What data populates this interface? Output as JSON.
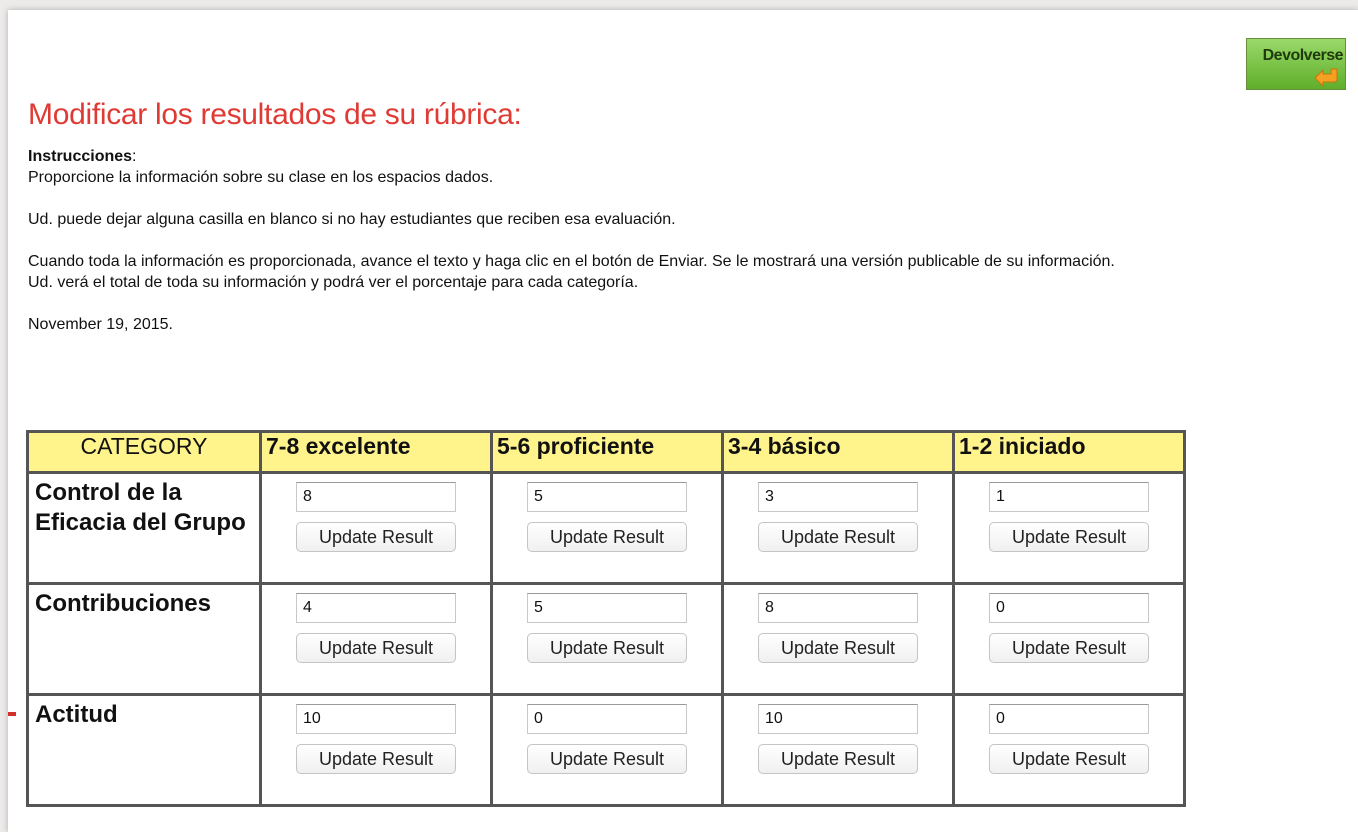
{
  "back_button": {
    "label": "Devolverse"
  },
  "page_title": "Modificar los resultados de su rúbrica:",
  "instructions": {
    "heading": "Instrucciones",
    "heading_suffix": ":",
    "lines": [
      "Proporcione la información sobre su clase en los espacios dados.",
      "Ud. puede dejar alguna casilla en blanco si no hay estudiantes que reciben esa evaluación.",
      "Cuando toda la información es proporcionada, avance el texto y haga clic en el botón de Enviar. Se le mostrará una versión publicable de su información. Ud. verá el total de toda su información y podrá ver el porcentaje para cada categoría."
    ],
    "date": "November 19, 2015."
  },
  "table": {
    "headers": [
      "CATEGORY",
      "7-8 excelente",
      "5-6 proficiente",
      "3-4 básico",
      "1-2 iniciado"
    ],
    "button_label": "Update Result",
    "rows": [
      {
        "label": "Control de la Eficacia del Grupo",
        "values": [
          "8",
          "5",
          "3",
          "1"
        ]
      },
      {
        "label": "Contribuciones",
        "values": [
          "4",
          "5",
          "8",
          "0"
        ]
      },
      {
        "label": "Actitud",
        "values": [
          "10",
          "0",
          "10",
          "0"
        ]
      }
    ]
  },
  "colors": {
    "title": "#e03a34",
    "header_bg": "#fff38c",
    "back_button": "#5fae2a"
  },
  "icons": {
    "back_button_icon": "arrow-left-icon"
  }
}
